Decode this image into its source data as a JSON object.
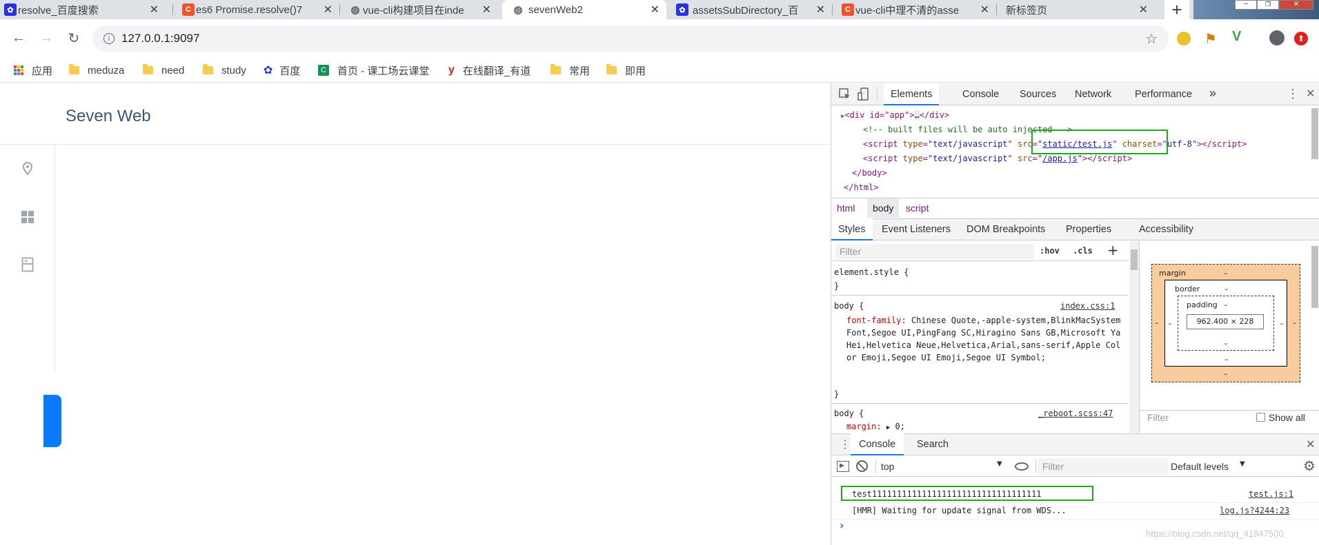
{
  "tabs": [
    {
      "title": "resolve_百度搜索",
      "icon": "baidu-icon"
    },
    {
      "title": "es6 Promise.resolve()7",
      "icon": "csdn-icon"
    },
    {
      "title": "vue-cli构建项目在inde",
      "icon": "globe-icon"
    },
    {
      "title": "sevenWeb2",
      "icon": "globe-icon"
    },
    {
      "title": "assetsSubDirectory_百",
      "icon": "baidu-icon"
    },
    {
      "title": "vue-cli中理不清的asse",
      "icon": "csdn-icon"
    },
    {
      "title": "新标签页",
      "icon": ""
    }
  ],
  "toolbar": {
    "url": "127.0.0.1:9097"
  },
  "bookmarks": [
    {
      "label": "应用",
      "icon": "apps-icon"
    },
    {
      "label": "meduza",
      "icon": "folder-icon"
    },
    {
      "label": "need",
      "icon": "folder-icon"
    },
    {
      "label": "study",
      "icon": "folder-icon"
    },
    {
      "label": "百度",
      "icon": "baidu-icon"
    },
    {
      "label": "首页 - 课工场云课堂",
      "icon": "kgc-icon"
    },
    {
      "label": "在线翻译_有道",
      "icon": "youdao-icon"
    },
    {
      "label": "常用",
      "icon": "folder-icon"
    },
    {
      "label": "即用",
      "icon": "folder-icon"
    }
  ],
  "page": {
    "brand": "Seven Web"
  },
  "devtools": {
    "tabs": [
      "Elements",
      "Console",
      "Sources",
      "Network",
      "Performance"
    ],
    "elements": {
      "line1": {
        "open": "<div id=\"app\">",
        "mid": "…",
        "close": "</div>"
      },
      "comment": "<!-- built files will be auto injected -->",
      "script1": {
        "type": "text/javascript",
        "src": "static/test.js",
        "charset": "utf-8"
      },
      "script2": {
        "type": "text/javascript",
        "src": "/app.js"
      },
      "body_close": "</body>",
      "html_close": "</html>"
    },
    "breadcrumbs": [
      "html",
      "body",
      "script"
    ],
    "subtabs": [
      "Styles",
      "Event Listeners",
      "DOM Breakpoints",
      "Properties",
      "Accessibility"
    ],
    "styles": {
      "filter_placeholder": "Filter",
      "hov": ":hov",
      "cls": ".cls",
      "element_style": "element.style {",
      "close_brace": "}",
      "rule1": {
        "selector": "body {",
        "source": "index.css:1",
        "prop": "font-family",
        "value": "Chinese Quote,-apple-system,BlinkMacSystemFont,Segoe UI,PingFang SC,Hiragino Sans GB,Microsoft YaHei,Helvetica Neue,Helvetica,Arial,sans-serif,Apple Color Emoji,Segoe UI Emoji,Segoe UI Symbol;"
      },
      "rule2": {
        "selector": "body {",
        "source": "_reboot.scss:47",
        "prop": "margin",
        "value": "0;"
      }
    },
    "box_model": {
      "margin": "margin",
      "border": "border",
      "padding": "padding",
      "dash": "–",
      "content": "962.400 × 228"
    },
    "computed": {
      "filter_placeholder": "Filter",
      "show_all": "Show all"
    },
    "drawer": {
      "tabs": [
        "Console",
        "Search"
      ],
      "context": "top",
      "filter_placeholder": "Filter",
      "levels": "Default levels",
      "messages": [
        {
          "text": "test1111111111111111111111111111111111",
          "source": "test.js:1"
        },
        {
          "text": "[HMR] Waiting for update signal from WDS...",
          "source": "log.js?4244:23"
        }
      ],
      "prompt": "›"
    },
    "watermark": "https://blog.csdn.net/qq_41947500"
  }
}
